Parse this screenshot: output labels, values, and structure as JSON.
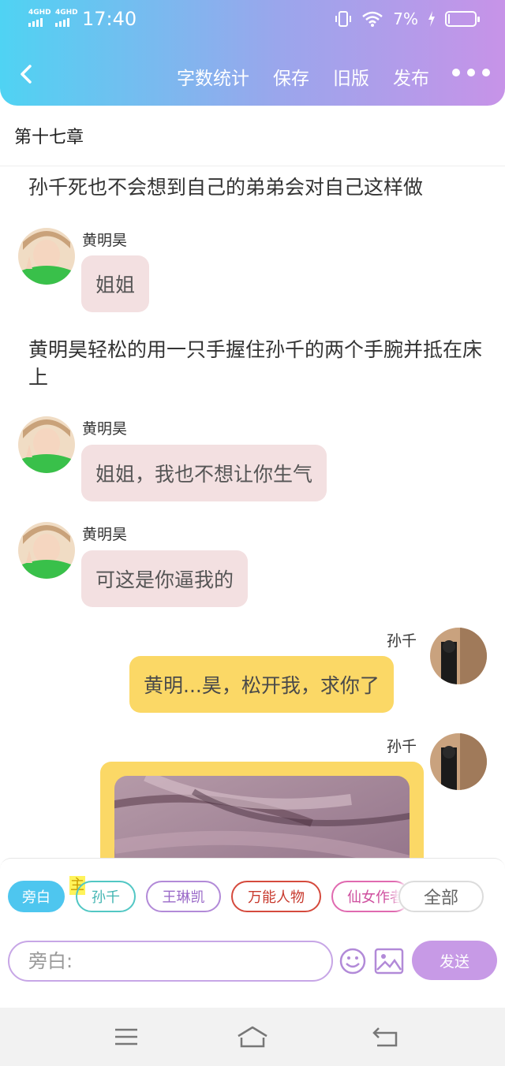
{
  "status": {
    "sim1": "4GHD",
    "sim2": "4GHD",
    "time": "17:40",
    "battery": "7%",
    "battery_level": 0.07
  },
  "topbar": {
    "word_count": "字数统计",
    "save": "保存",
    "old_version": "旧版",
    "publish": "发布"
  },
  "chapter_title": "第十七章",
  "messages": [
    {
      "type": "narration",
      "text": "孙千死也不会想到自己的弟弟会对自己这样做"
    },
    {
      "type": "left",
      "name": "黄明昊",
      "text": "姐姐"
    },
    {
      "type": "narration",
      "text": "黄明昊轻松的用一只手握住孙千的两个手腕并抵在床上"
    },
    {
      "type": "left",
      "name": "黄明昊",
      "text": "姐姐，我也不想让你生气"
    },
    {
      "type": "left",
      "name": "黄明昊",
      "text": "可这是你逼我的"
    },
    {
      "type": "right",
      "name": "孙千",
      "text": "黄明...昊，松开我，求你了"
    },
    {
      "type": "right-image",
      "name": "孙千"
    }
  ],
  "roles": {
    "items": [
      "旁白",
      "孙千",
      "王琳凯",
      "万能人物",
      "仙女作者"
    ],
    "owner_badge": "主",
    "all": "全部"
  },
  "composer": {
    "placeholder": "旁白:",
    "send": "发送"
  },
  "colors": {
    "header_start": "#4fd3f3",
    "header_end": "#c793e8",
    "pink_bubble": "#f3e0e1",
    "yellow_bubble": "#fbd866",
    "accent_blue": "#4ec6ef",
    "accent_purple": "#c79ae6"
  }
}
